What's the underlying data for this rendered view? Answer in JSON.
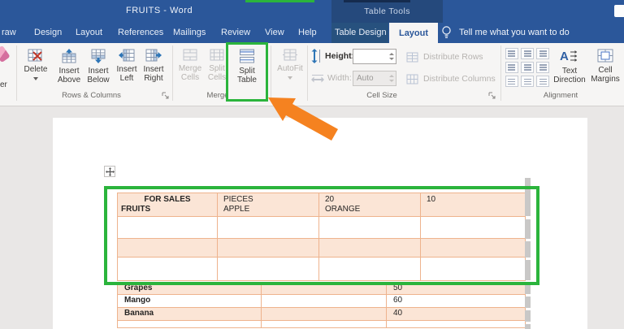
{
  "colors": {
    "ribbon_blue": "#2b579a",
    "contextual_blue": "#25497c",
    "highlight_green": "#2bb43c",
    "arrow_orange": "#f58220",
    "table_fill": "#fbe5d6",
    "table_border": "#eeb38d"
  },
  "title_bar": {
    "title": "FRUITS - Word",
    "contextual_label": "Table Tools"
  },
  "tabs": {
    "items": [
      "raw",
      "Design",
      "Layout",
      "References",
      "Mailings",
      "Review",
      "View",
      "Help",
      "Table Design",
      "Layout"
    ],
    "selected": "Layout",
    "tell_me": "Tell me what you want to do"
  },
  "ribbon": {
    "eraser_partial_label": "er",
    "rows_columns": {
      "label": "Rows & Columns",
      "delete": "Delete",
      "insert_above": {
        "l1": "Insert",
        "l2": "Above"
      },
      "insert_below": {
        "l1": "Insert",
        "l2": "Below"
      },
      "insert_left": {
        "l1": "Insert",
        "l2": "Left"
      },
      "insert_right": {
        "l1": "Insert",
        "l2": "Right"
      }
    },
    "merge": {
      "label": "Merge",
      "merge_cells": {
        "l1": "Merge",
        "l2": "Cells"
      },
      "split_cells": {
        "l1": "Split",
        "l2": "Cells"
      },
      "split_table": {
        "l1": "Split",
        "l2": "Table"
      }
    },
    "autofit": "AutoFit",
    "cell_size": {
      "label": "Cell Size",
      "height_label": "Height:",
      "height_value": "",
      "width_label": "Width:",
      "width_value": "Auto",
      "distribute_rows": "Distribute Rows",
      "distribute_columns": "Distribute Columns"
    },
    "alignment": {
      "label": "Alignment",
      "text_direction": {
        "l1": "Text",
        "l2": "Direction"
      },
      "cell_margins": {
        "l1": "Cell",
        "l2": "Margins"
      }
    }
  },
  "document": {
    "upper_table": {
      "header": [
        {
          "l1": "FOR SALES",
          "l2": "FRUITS"
        },
        {
          "l1": "PIECES",
          "l2": "APPLE"
        },
        {
          "l1": "20",
          "l2": "ORANGE"
        },
        {
          "l1": "10",
          "l2": ""
        }
      ]
    },
    "lower_table": {
      "rows": [
        {
          "fruit": "Grapes",
          "qty": "50"
        },
        {
          "fruit": "Mango",
          "qty": "60"
        },
        {
          "fruit": "Banana",
          "qty": "40"
        }
      ]
    }
  }
}
